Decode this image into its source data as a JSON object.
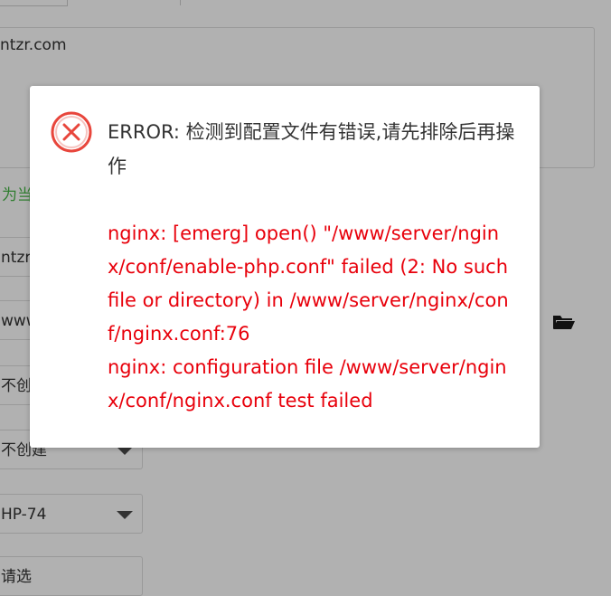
{
  "background": {
    "textarea_text": "ntzr.com",
    "hint_text": "为当",
    "fields": [
      {
        "value": "ntzr."
      },
      {
        "value": "www"
      },
      {
        "value": "不创建"
      },
      {
        "value": "不创建"
      },
      {
        "value": "HP-74"
      },
      {
        "value": "请选"
      }
    ],
    "folder_icon": "folder-open-icon"
  },
  "modal": {
    "icon": "error-circle-x-icon",
    "title": "ERROR: 检测到配置文件有错误,请先排除后再操作",
    "messages": [
      "nginx: [emerg] open() \"/www/server/nginx/conf/enable-php.conf\" failed (2: No such file or directory) in /www/server/nginx/conf/nginx.conf:76",
      "nginx: configuration file /www/server/nginx/conf/nginx.conf test failed"
    ]
  },
  "colors": {
    "overlay": "#b1b1b1",
    "error_text": "#e8000b",
    "icon_red": "#e8463c"
  }
}
